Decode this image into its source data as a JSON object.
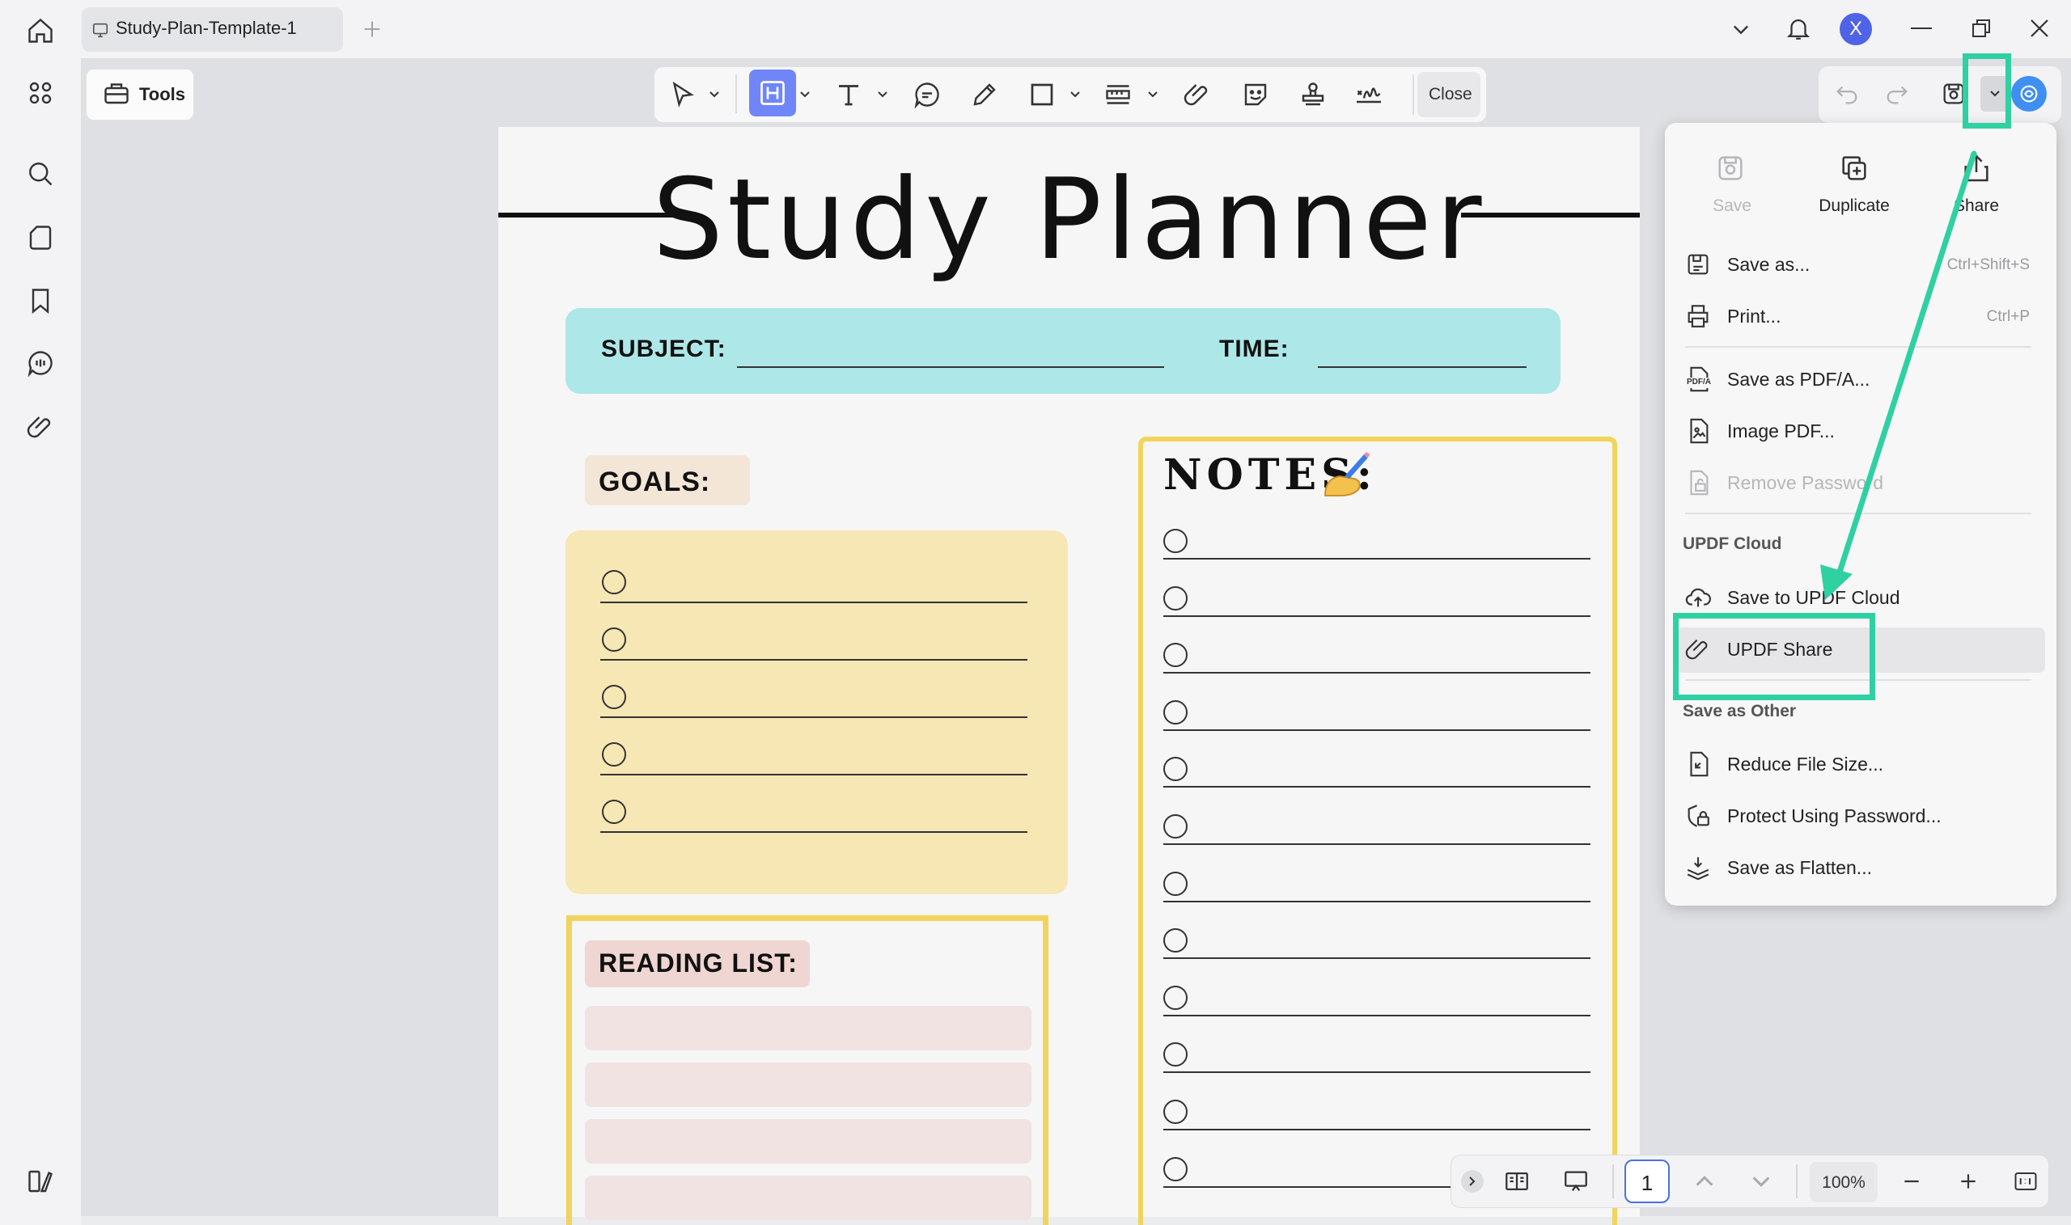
{
  "window": {
    "tab_title": "Study-Plan-Template-1",
    "avatar_letter": "X"
  },
  "toolbar": {
    "tools_label": "Tools",
    "close_label": "Close"
  },
  "document": {
    "title": "Study Planner",
    "subject_label": "SUBJECT:",
    "time_label": "TIME:",
    "goals_label": "GOALS:",
    "reading_list_label": "READING LIST:",
    "notes_label": "NOTES:",
    "goal_items": 5,
    "note_items": 12
  },
  "bottom_bar": {
    "page_number": "1",
    "zoom": "100%"
  },
  "menu": {
    "top_actions": [
      {
        "label": "Save",
        "icon": "save-icon",
        "enabled": false
      },
      {
        "label": "Duplicate",
        "icon": "duplicate-icon",
        "enabled": true
      },
      {
        "label": "Share",
        "icon": "share-icon",
        "enabled": true
      }
    ],
    "items": [
      {
        "label": "Save as...",
        "shortcut": "Ctrl+Shift+S"
      },
      {
        "label": "Print...",
        "shortcut": "Ctrl+P"
      },
      {
        "label": "Save as PDF/A..."
      },
      {
        "label": "Image PDF..."
      },
      {
        "label": "Remove Password"
      },
      {
        "label": "Save to UPDF Cloud"
      },
      {
        "label": "UPDF Share"
      },
      {
        "label": "Reduce File Size..."
      },
      {
        "label": "Protect Using Password..."
      },
      {
        "label": "Save as Flatten..."
      }
    ],
    "section_cloud": "UPDF Cloud",
    "section_other": "Save as Other",
    "pdfa_badge": "PDF/A"
  },
  "colors": {
    "highlight": "#2fd0a2",
    "accent": "#5b6cf6",
    "subject_band": "#ade7e8",
    "goals_box": "#f6e7b4",
    "border_yellow": "#f1d45c"
  }
}
